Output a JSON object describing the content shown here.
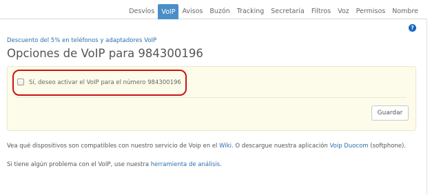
{
  "nav": {
    "tabs": [
      {
        "label": "Desvíos",
        "active": false
      },
      {
        "label": "VoIP",
        "active": true
      },
      {
        "label": "Avisos",
        "active": false
      },
      {
        "label": "Buzón",
        "active": false
      },
      {
        "label": "Tracking",
        "active": false
      },
      {
        "label": "Secretaria",
        "active": false
      },
      {
        "label": "Filtros",
        "active": false
      },
      {
        "label": "Voz",
        "active": false
      },
      {
        "label": "Permisos",
        "active": false
      },
      {
        "label": "Nombre",
        "active": false
      }
    ]
  },
  "help": {
    "glyph": "?",
    "icon": "help-icon"
  },
  "promo": {
    "link_text": "Descuento del 5% en teléfonos y adaptadores VoIP"
  },
  "page": {
    "title": "Opciones de VoIP para 984300196"
  },
  "form": {
    "checkbox_label": "Sí, deseo activar el VoIP para el número 984300196",
    "checked": false,
    "save_label": "Guardar"
  },
  "info1": {
    "text_before": "Vea qué dispositivos son compatibles con nuestro servicio de Voip en el ",
    "link1": "Wiki",
    "text_middle": ". O descargue nuestra aplicación ",
    "link2": "Voip Duocom",
    "text_after": " (softphone)."
  },
  "info2": {
    "text_before": "Si tiene algún problema con el VoIP, use nuestra ",
    "link": "herramienta de análisis",
    "text_after": "."
  },
  "colors": {
    "active_tab": "#4a8ec7",
    "link": "#2a6fb0",
    "highlight": "#cc1111",
    "panel_bg": "#fdfcea"
  }
}
